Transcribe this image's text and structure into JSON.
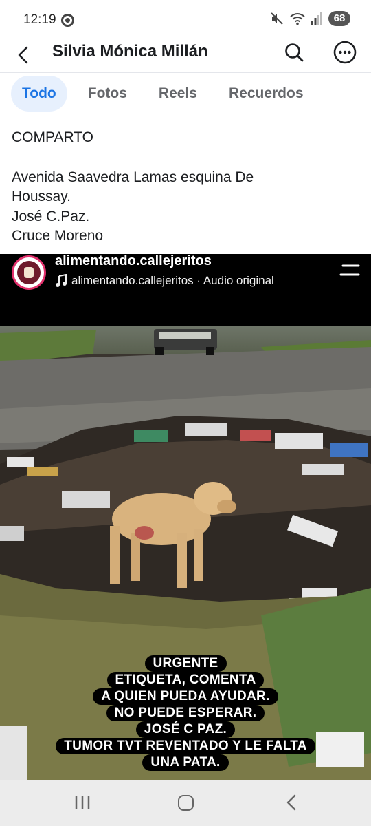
{
  "status_bar": {
    "time": "12:19",
    "battery": "68",
    "icons": [
      "mute-icon",
      "wifi-icon",
      "signal-icon",
      "battery-icon"
    ]
  },
  "header": {
    "title": "Silvia Mónica Millán",
    "icons": [
      "back-arrow-icon",
      "search-icon",
      "more-options-icon"
    ]
  },
  "tabs": [
    {
      "label": "Todo",
      "active": true
    },
    {
      "label": "Fotos",
      "active": false
    },
    {
      "label": "Reels",
      "active": false
    },
    {
      "label": "Recuerdos",
      "active": false
    }
  ],
  "post": {
    "lines": [
      "COMPARTO",
      "",
      "Avenida Saavedra Lamas esquina De",
      "Houssay.",
      "José C.Paz.",
      "Cruce Moreno"
    ]
  },
  "video": {
    "account": "alimentando.callejeritos",
    "audio": "alimentando.callejeritos · Audio original",
    "caption_lines": [
      "URGENTE",
      "ETIQUETA, COMENTA",
      "A QUIEN PUEDA AYUDAR.",
      "NO PUEDE ESPERAR.",
      "JOSÉ C PAZ.",
      "TUMOR TVT REVENTADO Y LE FALTA",
      "UNA PATA."
    ]
  },
  "colors": {
    "accent": "#1b74e4",
    "active_tab_bg": "#e7f0fd",
    "muted_text": "#65676b"
  }
}
